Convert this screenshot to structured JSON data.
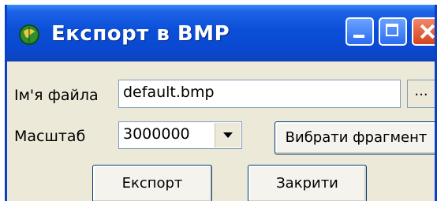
{
  "window": {
    "title": "Експорт в BMP"
  },
  "form": {
    "filename_label": "Ім'я файла",
    "filename_value": "default.bmp",
    "browse_label": "...",
    "scale_label": "Масштаб",
    "scale_value": "3000000",
    "select_fragment_label": "Вибрати фрагмент"
  },
  "buttons": {
    "export_label": "Експорт",
    "close_label": "Закрити"
  },
  "colors": {
    "titlebar": "#0a48cf",
    "window_bg": "#ece9d8",
    "close_button": "#d2451c"
  },
  "icons": {
    "app": "globe-app-icon",
    "minimize": "minimize-icon",
    "maximize": "maximize-icon",
    "close": "close-icon",
    "dropdown": "chevron-down-icon"
  }
}
